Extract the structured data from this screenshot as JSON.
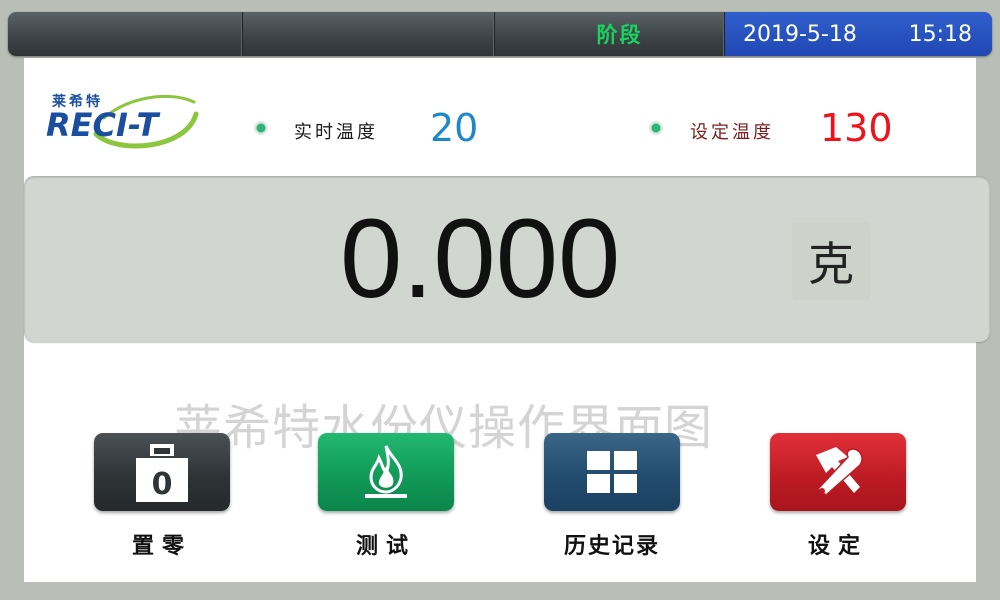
{
  "topbar": {
    "stage_label": "阶段",
    "date": "2019-5-18",
    "time": "15:18"
  },
  "logo": {
    "cn_text": "莱希特",
    "en_text": "RECI-T"
  },
  "realtime_temp": {
    "label": "实时温度",
    "value": "20",
    "color": "#1e88c9"
  },
  "set_temp": {
    "label": "设定温度",
    "value": "130",
    "color": "#f0121a"
  },
  "weight": {
    "value": "0.000",
    "unit": "克"
  },
  "watermark": "莱希特水份仪操作界面图",
  "buttons": {
    "zero": {
      "label": "置零",
      "icon": "weight-zero-icon",
      "icon_text": "0",
      "color": "#2f3437"
    },
    "test": {
      "label": "测试",
      "icon": "flame-icon",
      "color": "#119a58"
    },
    "history": {
      "label": "历史记录",
      "icon": "grid-icon",
      "color": "#224c6e"
    },
    "settings": {
      "label": "设定",
      "icon": "tools-icon",
      "color": "#bf1c25"
    }
  }
}
